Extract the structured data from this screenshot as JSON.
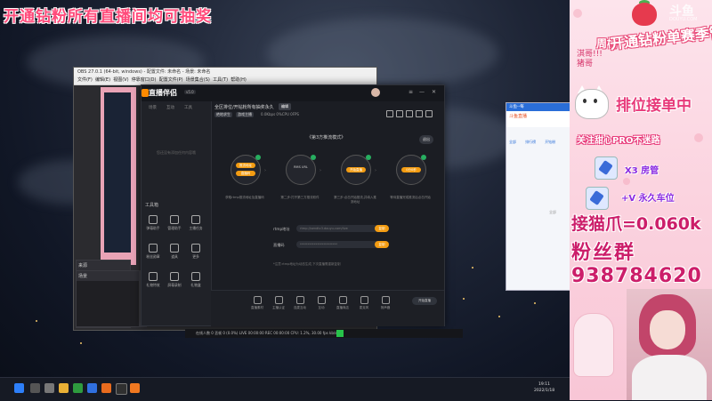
{
  "overlay_title": "开通钻粉所有直播间均可抽奖",
  "obs": {
    "title": "OBS 27.0.1 (64-bit, windows) - 配置文件: 未命名 - 场景: 未命名",
    "menu": [
      "文件(F)",
      "编辑(E)",
      "视图(V)",
      "停靠窗口(D)",
      "配置文件(P)",
      "场景集合(S)",
      "工具(T)",
      "帮助(H)"
    ],
    "scenes_label": "来源",
    "sources_label": "场景",
    "controls_label": "全屏"
  },
  "companion": {
    "brand": "直播伴侣",
    "version": "v5.0",
    "sidebar_tabs": [
      "场景",
      "互动",
      "工具"
    ],
    "sidebar_empty": "您还没有添加任何内容哦",
    "tools_label": "工具箱",
    "tools": [
      "弹幕助手",
      "管理助手",
      "主播任务",
      "粉丝勋章",
      "道具",
      "更多",
      "礼物特效",
      "屏幕录制",
      "礼物盒"
    ],
    "room_title": "全区排位/开钻粉所有抽奖永久",
    "room_tag": "编辑",
    "room_info_chip1": "绝地求生",
    "room_info_chip2": "游戏主播",
    "room_info": "0.0Kbps  0%CPU  0FPS",
    "section_title": "《第3方推流模式》",
    "exit_label": "退出",
    "steps": [
      {
        "btn1": "推流地址",
        "btn2": "直播码",
        "desc": "获取rtmp推流地址及直播码"
      },
      {
        "btn1": "RMS URL",
        "btn2": "",
        "desc": "第二步:打开第三方推流软件"
      },
      {
        "btn1": "开始直播",
        "btn2": "",
        "desc": "第三步:点击开始推流,并填入推流地址"
      },
      {
        "btn1": "0分0秒",
        "btn2": "",
        "desc": "等待直播完成推流后点击开始"
      }
    ],
    "rtmp_label": "rtmp地址",
    "rtmp_value": "rtmp://sendtc3.douyu.com/live",
    "code_label": "直播码",
    "code_value": "************************",
    "copy_label": "复制",
    "hint": "*注意:rtmp地址为动态生成,下次直播需重新复制",
    "bottom_items": [
      "直播素材",
      "主播认证",
      "连麦互动",
      "互动",
      "直播商店",
      "麦克风",
      "扬声器"
    ],
    "live_label": "开始直播"
  },
  "obs_status": "在线人数 0  丢帧 0 (0.0%)  LIVE 00:00:00  REC 00:00:00  CPU: 1.2%, 30.00 fps   kb/s: 0",
  "browser": {
    "title": "斗鱼--每",
    "header": "斗鱼直播",
    "tabs": [
      "全部",
      "排行榜",
      "开钻粉"
    ],
    "footer": "全部"
  },
  "taskbar": {
    "time": "19:11",
    "date": "2022/1/18"
  },
  "right_overlay": {
    "watermark": "斗鱼",
    "watermark_sub": "DOUYU.COM",
    "rank_title": "周榜",
    "rank_lines": [
      "淇哥!!!",
      "猪哥"
    ],
    "banner": "开通钻粉单赛季管理",
    "rank_service": "排位接单中",
    "follow_text": "关注甜心PRO不迷路",
    "gift1": "X3 房管",
    "gift2": "+V 永久车位",
    "claw": "接猫爪=0.060k",
    "fans": "粉丝群",
    "fans_num": "938784620"
  }
}
